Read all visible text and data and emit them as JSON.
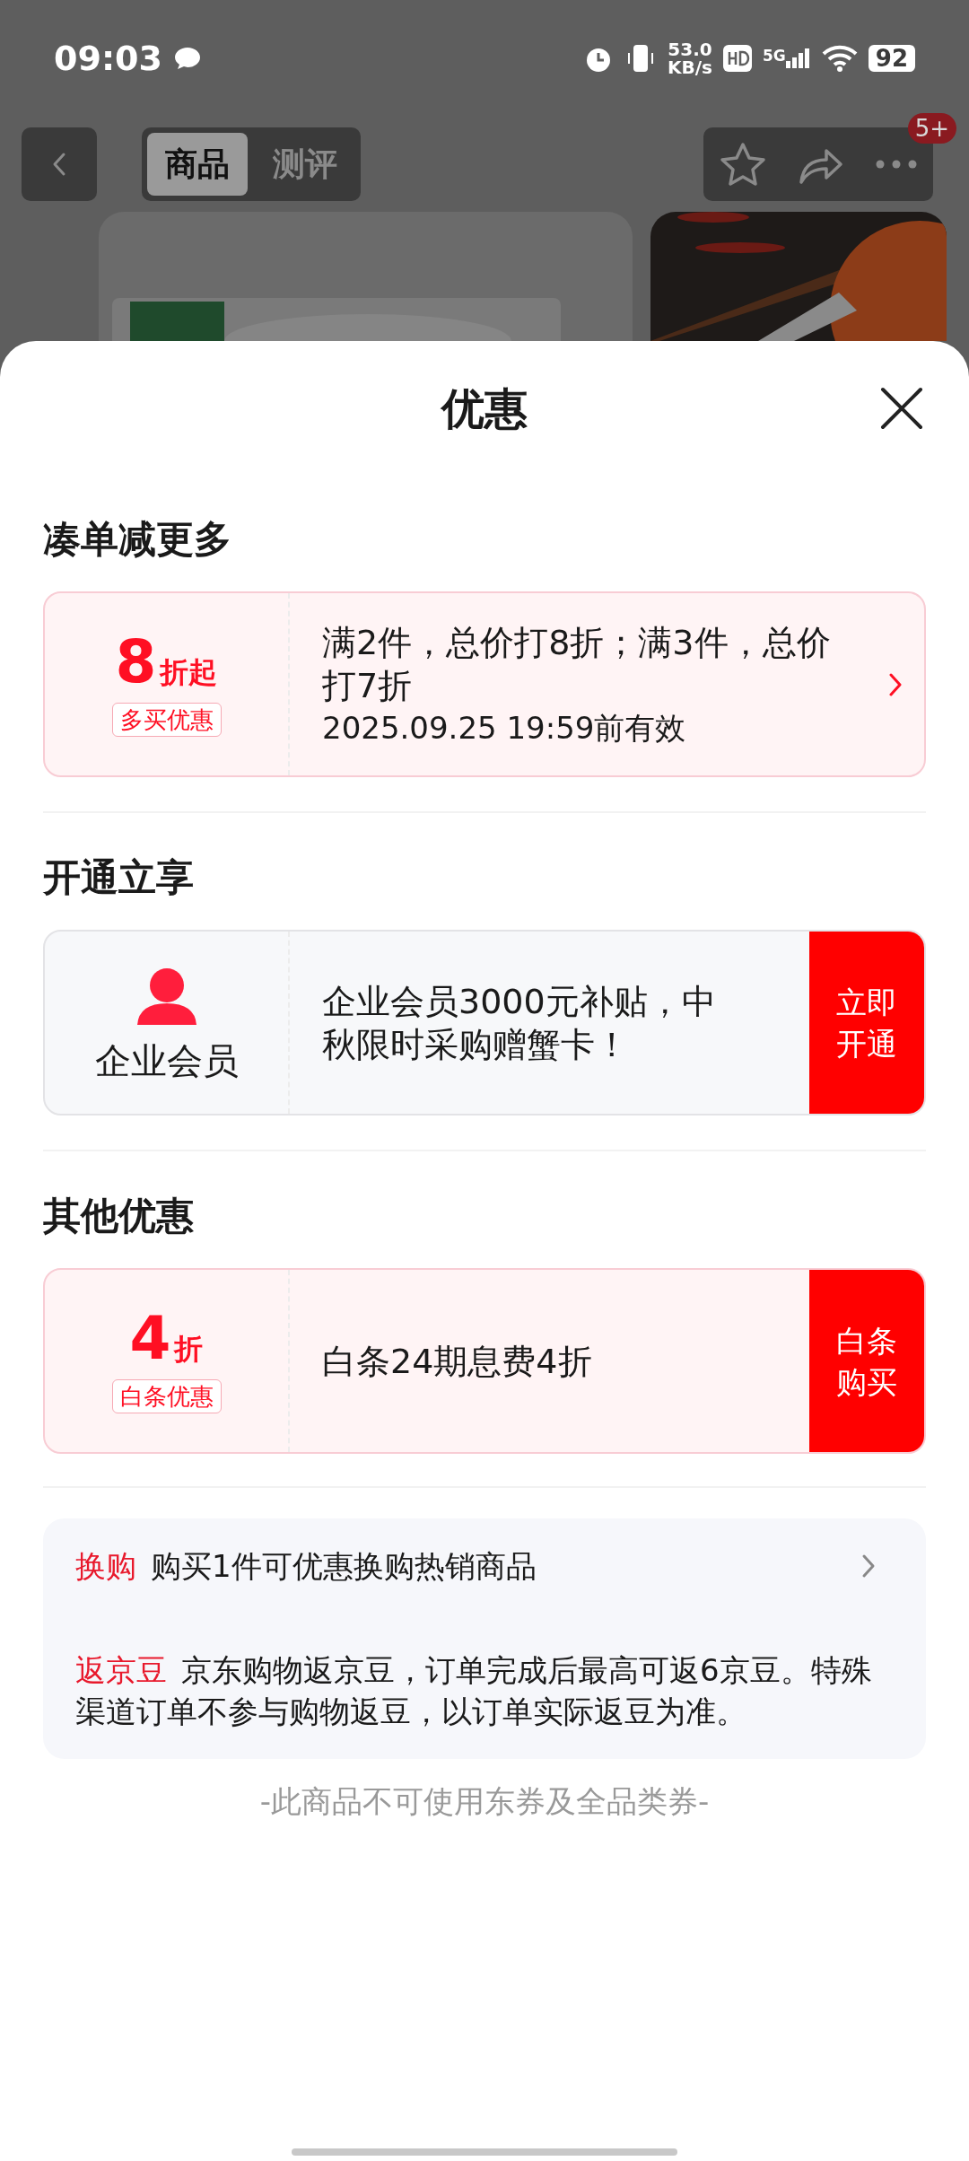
{
  "status_bar": {
    "time": "09:03",
    "speed": "53.0",
    "speed_unit": "KB/s",
    "network": "5G",
    "battery": "92"
  },
  "nav": {
    "tabs": [
      {
        "label": "商品",
        "selected": true
      },
      {
        "label": "测评",
        "selected": false
      }
    ],
    "badge": "5+"
  },
  "sheet": {
    "title": "优惠",
    "sections": [
      {
        "heading": "凑单减更多",
        "cards": [
          {
            "kind": "discount",
            "value": "8",
            "unit": "折起",
            "tag": "多买优惠",
            "text": "满2件，总价打8折；满3件，总价打7折",
            "note": "2025.09.25 19:59前有效"
          }
        ]
      },
      {
        "heading": "开通立享",
        "cards": [
          {
            "kind": "member",
            "label": "企业会员",
            "text": "企业会员3000元补贴，中秋限时采购赠蟹卡！",
            "button": "立即开通"
          }
        ]
      },
      {
        "heading": "其他优惠",
        "cards": [
          {
            "kind": "discount",
            "value": "4",
            "unit": "折",
            "tag": "白条优惠",
            "text": "白条24期息费4折",
            "button": "白条购买"
          }
        ]
      }
    ],
    "info": [
      {
        "label": "换购",
        "text": "购买1件可优惠换购热销商品",
        "chevron": true
      },
      {
        "label": "返京豆",
        "text": "京东购物返京豆，订单完成后最高可返6京豆。特殊渠道订单不参与购物返豆，以订单实际返豆为准。",
        "chevron": false
      }
    ],
    "footer": "-此商品不可使用东券及全品类券-"
  }
}
